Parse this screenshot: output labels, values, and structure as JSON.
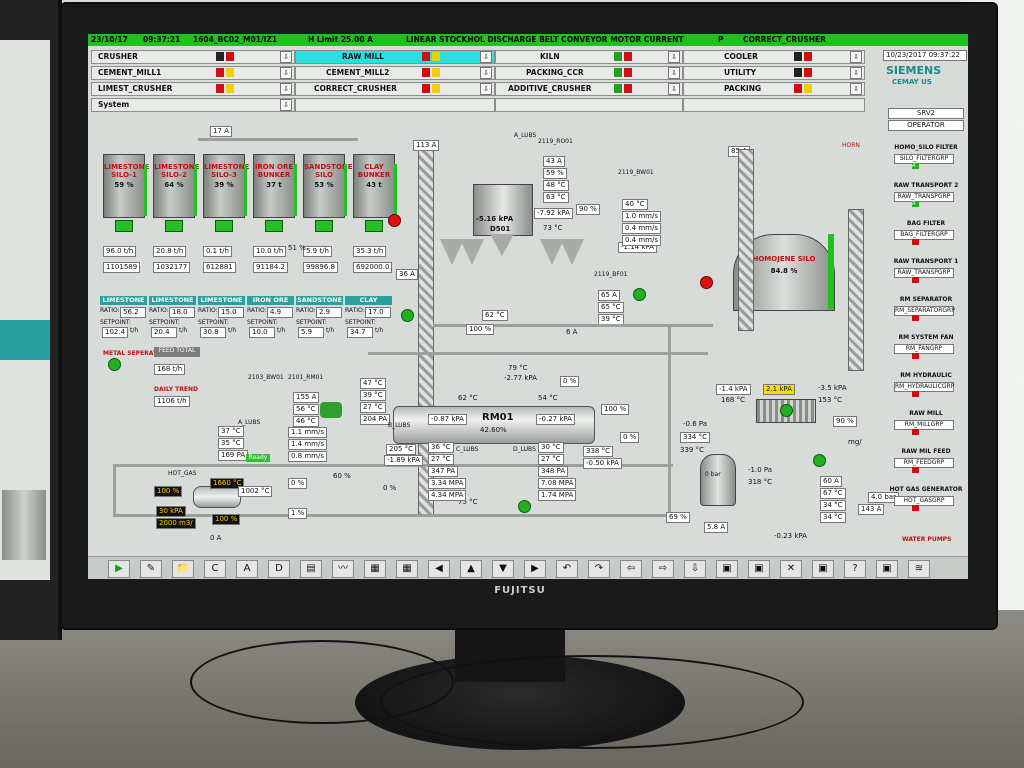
{
  "monitor": {
    "brand": "FUJITSU"
  },
  "topbar": {
    "date": "23/10/17",
    "time": "09:37:21",
    "tag": "1604_BC02_M01/IZ1",
    "limit": "H Limit  25.00 A",
    "message": "LINEAR STOCKHOL DISCHARGE BELT CONVEYOR MOTOR CURRENT",
    "flag": "P",
    "area": "CORRECT_CRUSHER"
  },
  "header": {
    "timestamp": "10/23/2017 09:37:22",
    "logo": "SIEMENS",
    "subtitle": "CEMAY US",
    "srv": "SRV2",
    "operator": "OPERATOR"
  },
  "nav": [
    [
      "CRUSHER",
      "RAW MILL",
      "KILN",
      "COOLER"
    ],
    [
      "CEMENT_MILL1",
      "CEMENT_MILL2",
      "PACKING_CCR",
      "UTILITY"
    ],
    [
      "LIMEST_CRUSHER",
      "CORRECT_CRUSHER",
      "ADDITIVE_CRUSHER",
      "PACKING"
    ],
    [
      "System",
      "",
      "",
      ""
    ]
  ],
  "silos": [
    {
      "name": "LIMESTONE SILO-1",
      "pct": "59 %",
      "rate": "96.0 t/h",
      "total": "1101589"
    },
    {
      "name": "LIMESTONE SILO-2",
      "pct": "64 %",
      "rate": "20.8 t/h",
      "total": "1032177"
    },
    {
      "name": "LIMESTONE SILO-3",
      "pct": "39 %",
      "rate": "0.1 t/h",
      "total": "612881"
    },
    {
      "name": "IRON ORE BUNKER",
      "pct": "37 t",
      "rate": "10.0 t/h",
      "total": "91184.2"
    },
    {
      "name": "SANDSTONE SILO",
      "pct": "53 %",
      "rate": "5.9 t/h",
      "total": "99896.8"
    },
    {
      "name": "CLAY BUNKER",
      "pct": "43 t",
      "rate": "35.3 t/h",
      "total": "692000.0"
    }
  ],
  "feed_tabs": [
    "LIMESTONE 1",
    "LIMESTONE 2",
    "LIMESTONE 3",
    "IRON ORE",
    "SANDSTONE",
    "CLAY"
  ],
  "feed_ratio": [
    "56.2",
    "18.0",
    "15.0",
    "4.9",
    "2.9",
    "17.0"
  ],
  "feed_setpoint": [
    "102.4",
    "20.4",
    "30.8",
    "10.0",
    "5.9",
    "34.7"
  ],
  "feed_labels": {
    "ratio": "RATIO:",
    "setpoint": "SETPOINT:",
    "unit": "t/h"
  },
  "misc": {
    "conveyor_current": "17 A",
    "bucket_current": "113 A",
    "mill_current": "36 A",
    "sep_current": "85 A",
    "metal_sep": "METAL SEPERATOR",
    "feed_total_label": "FEED TOTAL",
    "feed_total": "168 t/h",
    "daily_trend": "DAILY TREND",
    "daily_value": "1106 t/h",
    "pct_51": "51 %",
    "pct_100": "100 %",
    "pct_0": "0 %",
    "temp_62": "62 °C",
    "temp_79": "79 °C",
    "press_277": "-2.77 kPA",
    "pct_6": "6 A"
  },
  "cyclone": {
    "label": "A_LUBS",
    "id": "2119_RO01",
    "gauge": "-5.16 kPA",
    "sub": "D501",
    "a": "43 A",
    "b": "59 %",
    "c": "48 °C",
    "d": "63 °C",
    "e": "-7.92 kPA",
    "f": "73 °C",
    "pct": "90 %",
    "press": "-1.14 kPA"
  },
  "classifier": {
    "id": "2119_BW01",
    "t1": "40 °C",
    "v1": "1.0 mm/s",
    "v2": "0.4 mm/s",
    "v3": "0.4 mm/s"
  },
  "fan": {
    "id": "2119_BF01",
    "a": "65 A",
    "b": "65 °C",
    "c": "39 °C"
  },
  "homo": {
    "name": "HOMOJENE SILO",
    "pct": "84.8 %",
    "horn": "HORN"
  },
  "mill": {
    "name": "RM01",
    "value": "42.60%",
    "left_press": "-0.87 kPA",
    "right_press": "-0.27 kPA",
    "motor": {
      "a": "155 A",
      "b": "56 °C",
      "c": "46 °C",
      "d": "47 °C",
      "e": "39 °C",
      "f": "27 °C",
      "g": "204 PA"
    },
    "vib": {
      "a": "1.1 mm/s",
      "b": "1.4 mm/s",
      "c": "0.8 mm/s"
    },
    "lub_l": {
      "a": "37 °C",
      "b": "35 °C",
      "c": "169 PA"
    },
    "bear_l": {
      "a": "205 °C",
      "b": "-1.89 kPA",
      "c": "36 °C",
      "d": "27 °C",
      "e": "347 PA",
      "f": "3.34 MPA",
      "g": "4.34 MPA"
    },
    "bear_r": {
      "a": "30 °C",
      "b": "27 °C",
      "c": "348 PA",
      "d": "7.08 MPA",
      "e": "1.74 MPA",
      "f": "338 °C",
      "g": "-0.50 kPA"
    },
    "ids": [
      "2103_BW01",
      "2101_RM01",
      "A_LUBS",
      "B_LUBS",
      "C_LUBS",
      "D_LUBS"
    ],
    "outlet": "75 °C",
    "ready": "Ready",
    "r1": "62 °C",
    "r2": "54 °C",
    "pct100": "100 %"
  },
  "hotgas": {
    "label": "HOT_GAS",
    "a": "1660 °C",
    "b": "100 %",
    "c": "1002 °C",
    "d": "30 kPA",
    "e": "2000 m3/",
    "f": "100 %",
    "g": "0 A",
    "pct1": "0 %",
    "pct2": "1 %",
    "pct3": "60 %",
    "pct4": "0 %"
  },
  "right": {
    "a": "-1.4 kPA",
    "b": "168 °C",
    "c": "2.1 kPA",
    "d": "-3.5 kPA",
    "e": "153 °C",
    "f": "-0.6 Pa",
    "g": "334 °C",
    "h": "339 °C",
    "i": "-1.0 Pa",
    "j": "318 °C",
    "k": "60 A",
    "l": "67 °C",
    "m": "34 °C",
    "n": "34 °C",
    "o": "0 bar",
    "p": "5.8 A",
    "q": "-0.23 kPA",
    "r": "90 %",
    "s": "69 %",
    "t": "143 A",
    "u": "4.0 bar",
    "v": "0 %",
    "w": "mg/"
  },
  "sidebar": [
    {
      "title": "HOMO_SILO FILTER",
      "box": "SILO_FILTERGRP",
      "st": "A"
    },
    {
      "title": "RAW TRANSPORT 2",
      "box": "RAW_TRANSPGRP",
      "st": "A"
    },
    {
      "title": "BAG FILTER",
      "box": "BAG_FILTERGRP",
      "st": ""
    },
    {
      "title": "RAW TRANSPORT 1",
      "box": "RAW_TRANSPGRP",
      "st": ""
    },
    {
      "title": "RM SEPARATOR",
      "box": "RM_SEPARATORGRP",
      "st": ""
    },
    {
      "title": "RM SYSTEM FAN",
      "box": "RM_FANGRP",
      "st": ""
    },
    {
      "title": "RM HYDRAULIC",
      "box": "RM_HYDRAULICGRP",
      "st": ""
    },
    {
      "title": "RAW MILL",
      "box": "RM_MILLGRP",
      "st": ""
    },
    {
      "title": "RAW MIL FEED",
      "box": "RM_FEEDGRP",
      "st": ""
    },
    {
      "title": "HOT GAS GENERATOR",
      "box": "HOT_GASGRP",
      "st": ""
    }
  ],
  "sidebar_footer": "WATER PUMPS",
  "toolbar": [
    "▶",
    "✎",
    "📁",
    "C",
    "A",
    "D",
    "▤",
    "〰",
    "▦",
    "▦",
    "◀",
    "▲",
    "▼",
    "▶",
    "↶",
    "↷",
    "⇦",
    "⇨",
    "⇩",
    "▣",
    "▣",
    "✕",
    "▣",
    "?",
    "▣",
    "≋"
  ]
}
